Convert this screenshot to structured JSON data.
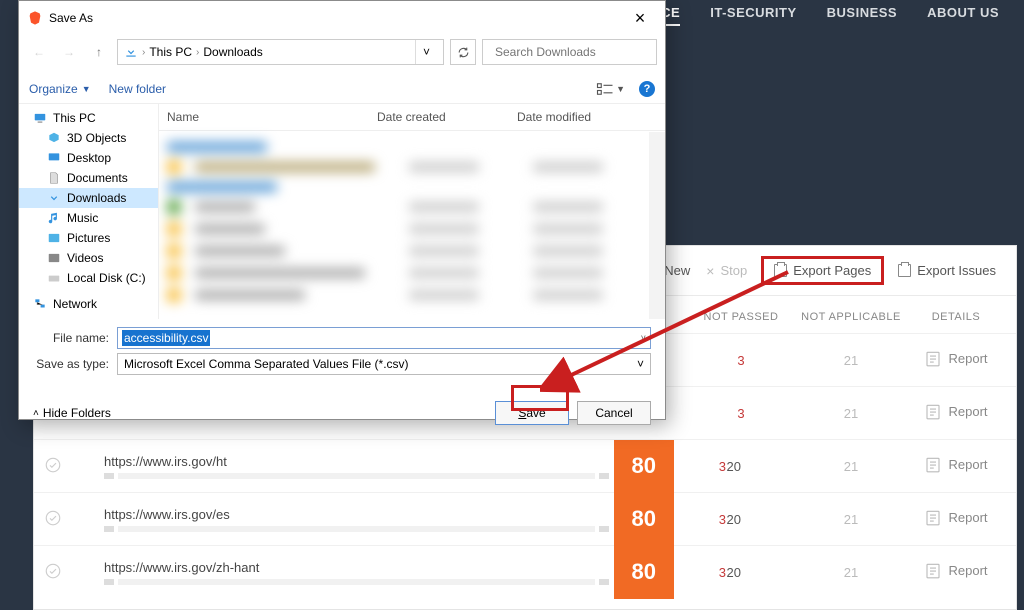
{
  "nav": [
    {
      "label": "MMERCE",
      "active": true
    },
    {
      "label": "IT-SECURITY",
      "active": false
    },
    {
      "label": "BUSINESS",
      "active": false
    },
    {
      "label": "ABOUT US",
      "active": false
    }
  ],
  "actions": {
    "new": "New",
    "stop": "Stop",
    "export_pages": "Export Pages",
    "export_issues": "Export Issues"
  },
  "columns": {
    "not_passed": "NOT PASSED",
    "not_applicable": "NOT APPLICABLE",
    "details": "DETAILS"
  },
  "rows": [
    {
      "url": "",
      "score": "",
      "np": "3",
      "na": "21",
      "report": "Report"
    },
    {
      "url": "",
      "score": "",
      "np": "3",
      "na": "21",
      "report": "Report"
    },
    {
      "url": "https://www.irs.gov/ht",
      "score": "80",
      "np": "20",
      "np2": "3",
      "na": "21",
      "report": "Report"
    },
    {
      "url": "https://www.irs.gov/es",
      "score": "80",
      "np": "20",
      "np2": "3",
      "na": "21",
      "report": "Report"
    },
    {
      "url": "https://www.irs.gov/zh-hant",
      "score": "80",
      "np": "20",
      "np2": "3",
      "na": "21",
      "report": "Report"
    }
  ],
  "dialog": {
    "title": "Save As",
    "path": {
      "segment1": "This PC",
      "segment2": "Downloads"
    },
    "search_placeholder": "Search Downloads",
    "organize": "Organize",
    "new_folder": "New folder",
    "tree": [
      {
        "label": "This PC",
        "icon": "pc"
      },
      {
        "label": "3D Objects",
        "icon": "3d"
      },
      {
        "label": "Desktop",
        "icon": "desktop"
      },
      {
        "label": "Documents",
        "icon": "doc"
      },
      {
        "label": "Downloads",
        "icon": "down",
        "selected": true
      },
      {
        "label": "Music",
        "icon": "music"
      },
      {
        "label": "Pictures",
        "icon": "pic"
      },
      {
        "label": "Videos",
        "icon": "video"
      },
      {
        "label": "Local Disk (C:)",
        "icon": "disk"
      },
      {
        "label": "Network",
        "icon": "net"
      }
    ],
    "file_cols": {
      "name": "Name",
      "created": "Date created",
      "modified": "Date modified"
    },
    "filename_label": "File name:",
    "filename_value": "accessibility.csv",
    "savetype_label": "Save as type:",
    "savetype_value": "Microsoft Excel Comma Separated Values File (*.csv)",
    "hide_folders": "Hide Folders",
    "save_btn": "Save",
    "cancel_btn": "Cancel"
  }
}
